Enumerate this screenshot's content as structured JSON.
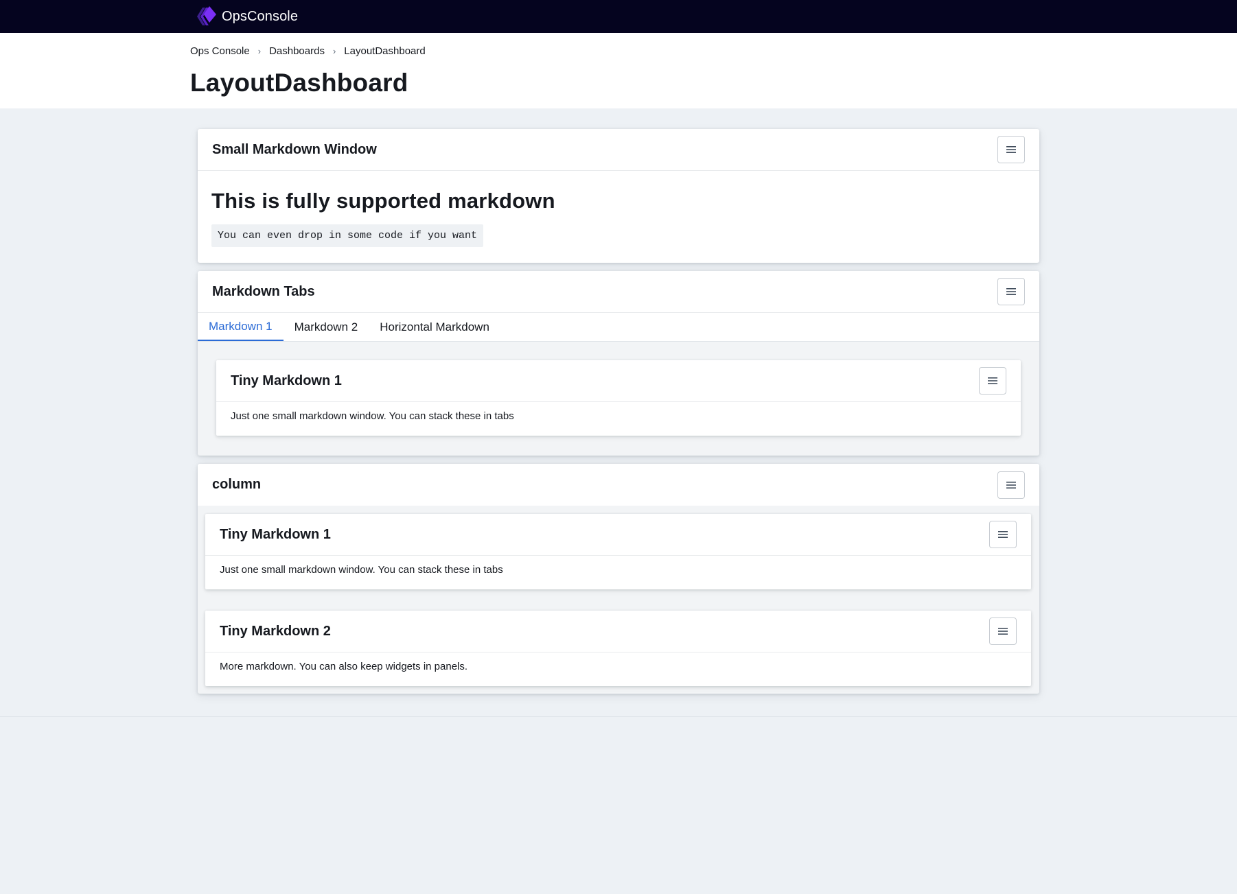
{
  "app": {
    "name": "OpsConsole"
  },
  "breadcrumb": {
    "items": [
      "Ops Console",
      "Dashboards",
      "LayoutDashboard"
    ],
    "separator": "›"
  },
  "page": {
    "title": "LayoutDashboard"
  },
  "panels": {
    "small_markdown": {
      "title": "Small Markdown Window",
      "heading": "This is fully supported markdown",
      "code": "You can even drop in some code if you want"
    },
    "markdown_tabs": {
      "title": "Markdown Tabs",
      "tabs": [
        "Markdown 1",
        "Markdown 2",
        "Horizontal Markdown"
      ],
      "active_tab": "Markdown 1",
      "card": {
        "title": "Tiny Markdown 1",
        "text": "Just one small markdown window. You can stack these in tabs"
      }
    },
    "column": {
      "title": "column",
      "cards": [
        {
          "title": "Tiny Markdown 1",
          "text": "Just one small markdown window. You can stack these in tabs"
        },
        {
          "title": "Tiny Markdown 2",
          "text": "More markdown. You can also keep widgets in panels."
        }
      ]
    }
  },
  "icons": {
    "logo": "opsconsole-logo",
    "menu": "hamburger-menu-icon"
  },
  "colors": {
    "topbar": "#05041f",
    "accent": "#2b6bd6",
    "logo_purple": "#7b2ff7",
    "background": "#edf1f5"
  }
}
